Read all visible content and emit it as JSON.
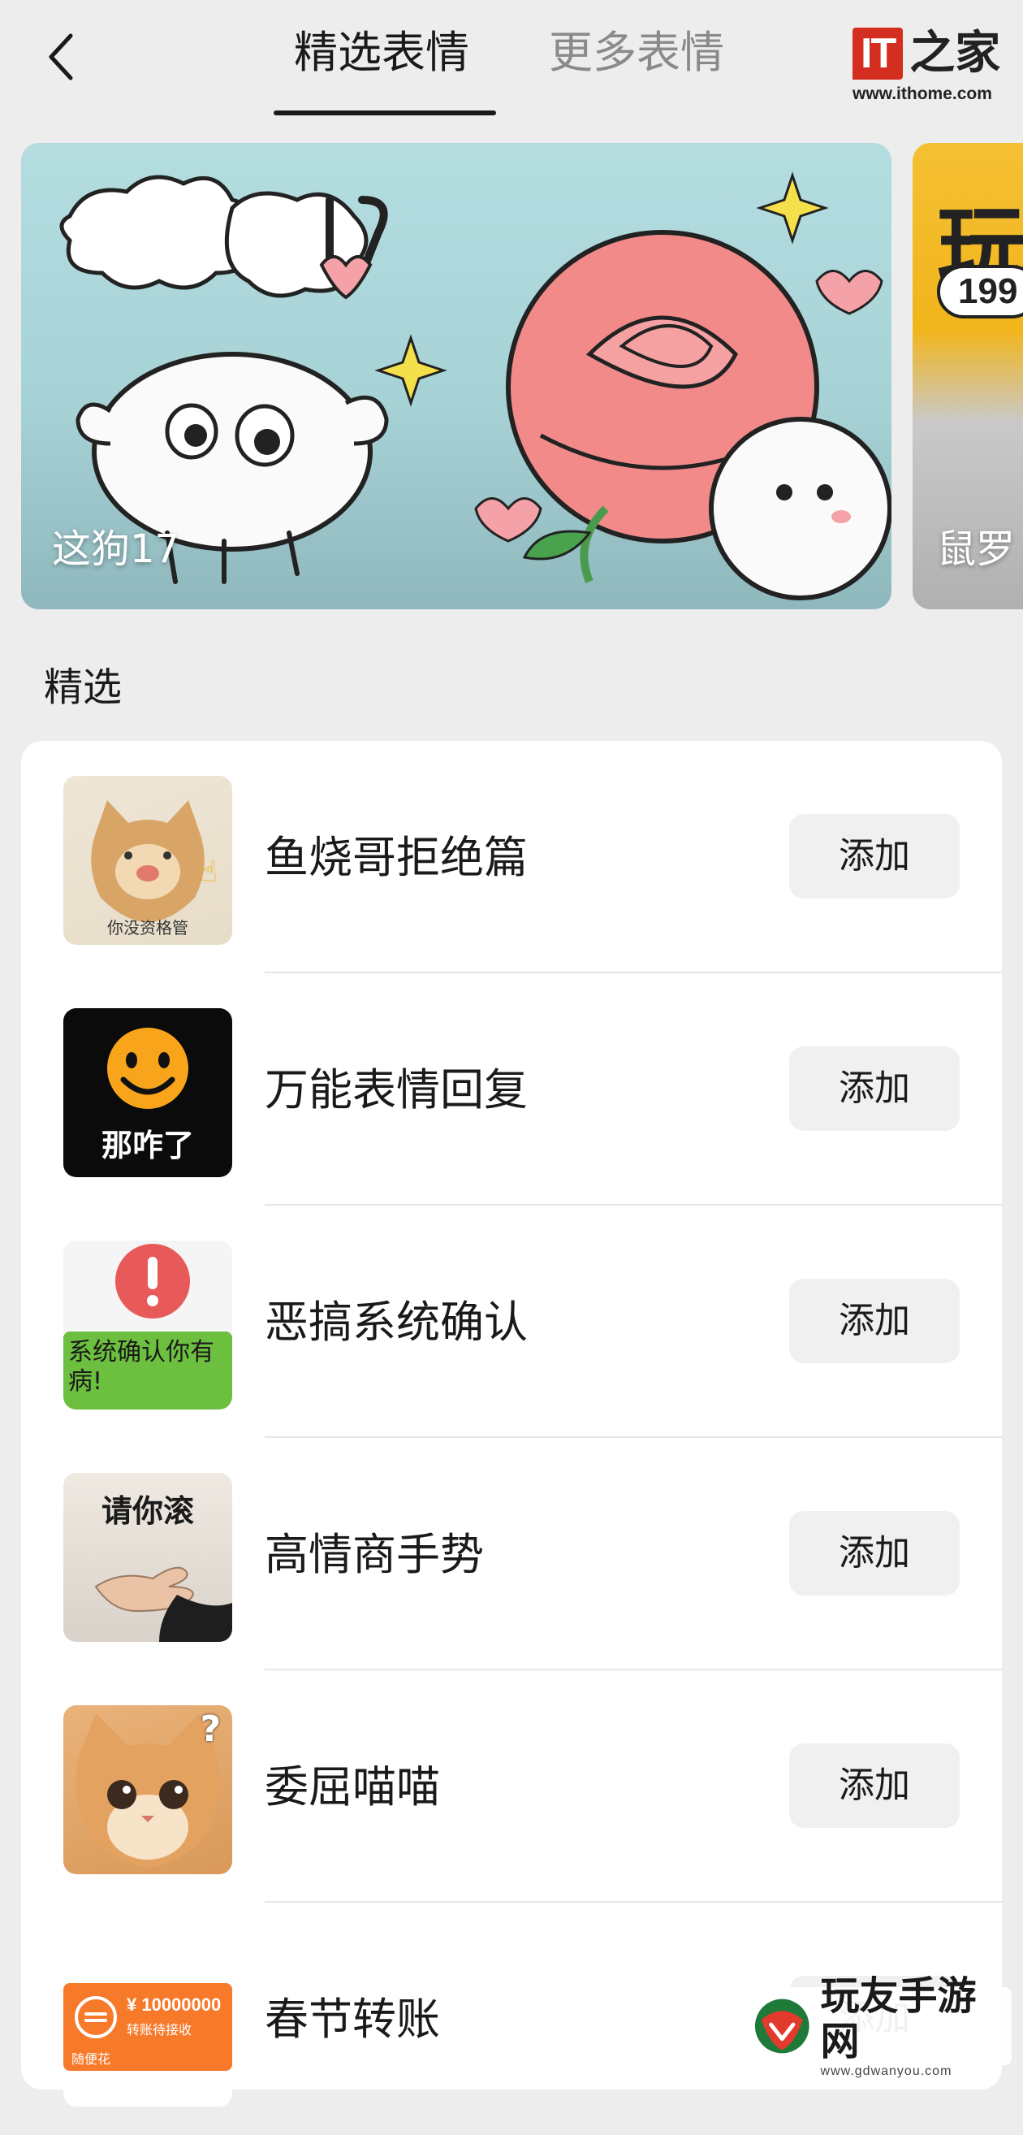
{
  "header": {
    "tabs": [
      {
        "label": "精选表情",
        "active": true
      },
      {
        "label": "更多表情",
        "active": false
      }
    ],
    "brand": {
      "logo_text": "IT",
      "logo_suffix": "之家",
      "url": "www.ithome.com"
    }
  },
  "banners": [
    {
      "title": "这狗17"
    },
    {
      "title": "鼠罗",
      "big_text": "玩",
      "badge": "199"
    }
  ],
  "section": {
    "title": "精选"
  },
  "packs": [
    {
      "name": "鱼烧哥拒绝篇",
      "action": "添加",
      "thumb_text": "你没资格管"
    },
    {
      "name": "万能表情回复",
      "action": "添加",
      "thumb_text": "那咋了"
    },
    {
      "name": "恶搞系统确认",
      "action": "添加",
      "thumb_text": "系统确认你有病!"
    },
    {
      "name": "高情商手势",
      "action": "添加",
      "thumb_text": "请你滚"
    },
    {
      "name": "委屈喵喵",
      "action": "添加",
      "thumb_text": "?"
    },
    {
      "name": "春节转账",
      "action": "添加",
      "thumb_text_amount": "¥ 10000000",
      "thumb_text_sub": "转账待接收",
      "thumb_text_foot": "随便花"
    }
  ],
  "watermark": {
    "name": "玩友手游网",
    "url": "www.gdwanyou.com"
  },
  "colors": {
    "background": "#ededed",
    "card": "#ffffff",
    "button_bg": "#f0f0f0",
    "brand_red": "#d42e20",
    "transfer_orange": "#f7792a"
  }
}
